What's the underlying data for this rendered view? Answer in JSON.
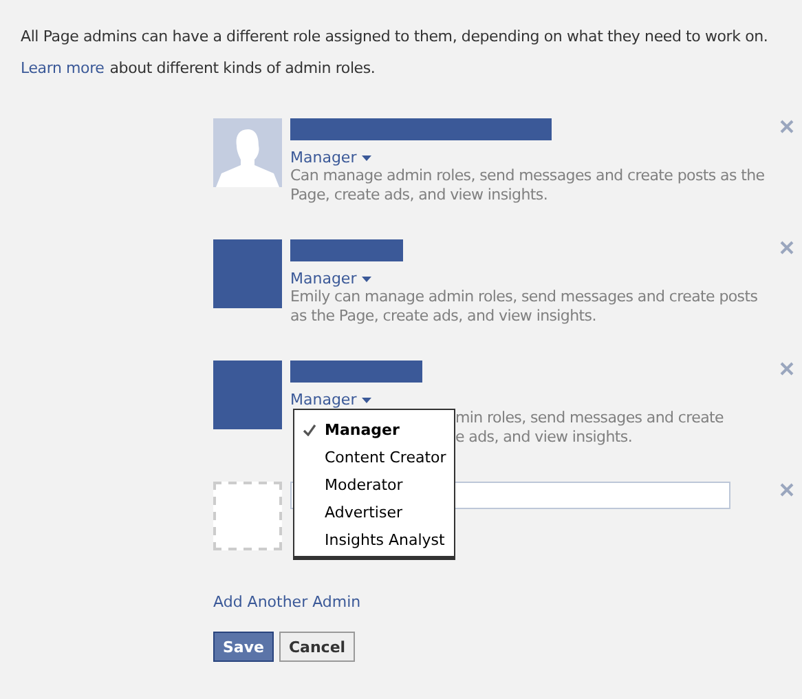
{
  "intro": "All Page admins can have a different role assigned to them, depending on what they need to work on.",
  "learn_more": {
    "link": "Learn more",
    "text": "about different kinds of admin roles."
  },
  "admins": [
    {
      "kind": "silhouette",
      "role": "Manager",
      "description": [
        "Can manage admin roles, send messages and create posts as the",
        "Page, create ads, and view insights."
      ],
      "covered": false
    },
    {
      "kind": "redacted",
      "role": "Manager",
      "description": [
        "Emily can manage admin roles, send messages and create posts",
        "as the Page, create ads, and view insights."
      ],
      "covered": false
    },
    {
      "kind": "redacted",
      "role": "Manager",
      "description": [
        "min roles, send messages and create",
        "e ads, and view insights."
      ],
      "covered": true
    }
  ],
  "role_menu": [
    {
      "label": "Manager",
      "selected": true
    },
    {
      "label": "Content Creator",
      "selected": false
    },
    {
      "label": "Moderator",
      "selected": false
    },
    {
      "label": "Advertiser",
      "selected": false
    },
    {
      "label": "Insights Analyst",
      "selected": false
    }
  ],
  "add_another": "Add Another Admin",
  "buttons": [
    {
      "label": "Save",
      "kind": "primary"
    },
    {
      "label": "Cancel",
      "kind": "secondary"
    }
  ]
}
